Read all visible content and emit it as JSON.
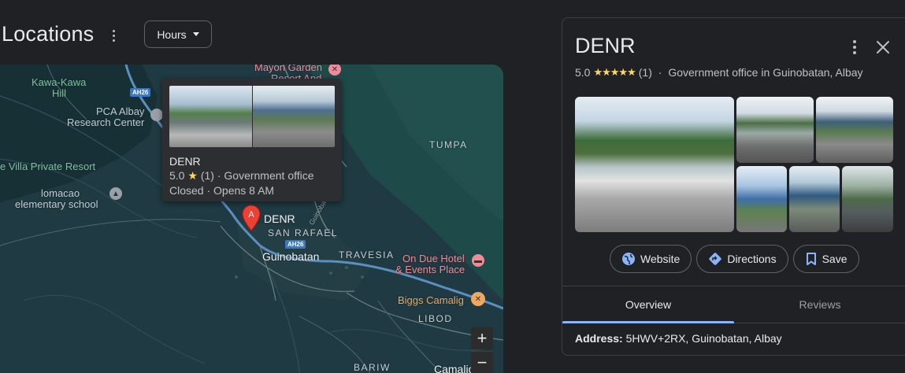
{
  "header": {
    "title": "Locations",
    "more_icon": "more-vert-icon",
    "hours_button": "Hours"
  },
  "map": {
    "labels": {
      "mayon_garden": "Mayon Garden",
      "mayon_garden_2": "Resort And",
      "kawa_kawa": "Kawa-Kawa",
      "kawa_hill": "Hill",
      "pca_albay": "PCA Albay",
      "research_center": "Research Center",
      "villa_resort": "e Villa Private Resort",
      "lomacao": "lomacao",
      "elementary": "elementary school",
      "tumpa": "TUMPA",
      "san_rafael": "SAN RAFAEL",
      "guinobatan": "Guinobatan",
      "travesia": "TRAVESIA",
      "on_due_hotel": "On Due Hotel",
      "events_place": "& Events Place",
      "biggs": "Biggs Camalig",
      "libod": "LIBOD",
      "bariw": "BARIW",
      "camalig": "Camalig",
      "guinobatan_road": "Guinobatan",
      "ah26_a": "AH26",
      "ah26_b": "AH26"
    },
    "marker": {
      "letter": "A",
      "label": "DENR"
    },
    "popup": {
      "name": "DENR",
      "rating": "5.0",
      "reviews": "(1)",
      "category": "Government office",
      "status": "Closed",
      "hours": "Opens 8 AM"
    },
    "zoom_in": "+",
    "zoom_out": "−"
  },
  "panel": {
    "title": "DENR",
    "rating": "5.0",
    "stars": "★★★★★",
    "reviews": "(1)",
    "category": "Government office in Guinobatan, Albay",
    "actions": {
      "website": "Website",
      "directions": "Directions",
      "save": "Save"
    },
    "tabs": [
      "Overview",
      "Reviews"
    ],
    "address_label": "Address:",
    "address_value": "5HWV+2RX, Guinobatan, Albay"
  },
  "colors": {
    "background": "#202124",
    "map_land": "#1f3a42",
    "accent_blue": "#8ab4f8",
    "star": "#fdd663",
    "marker_red": "#ea4335"
  }
}
